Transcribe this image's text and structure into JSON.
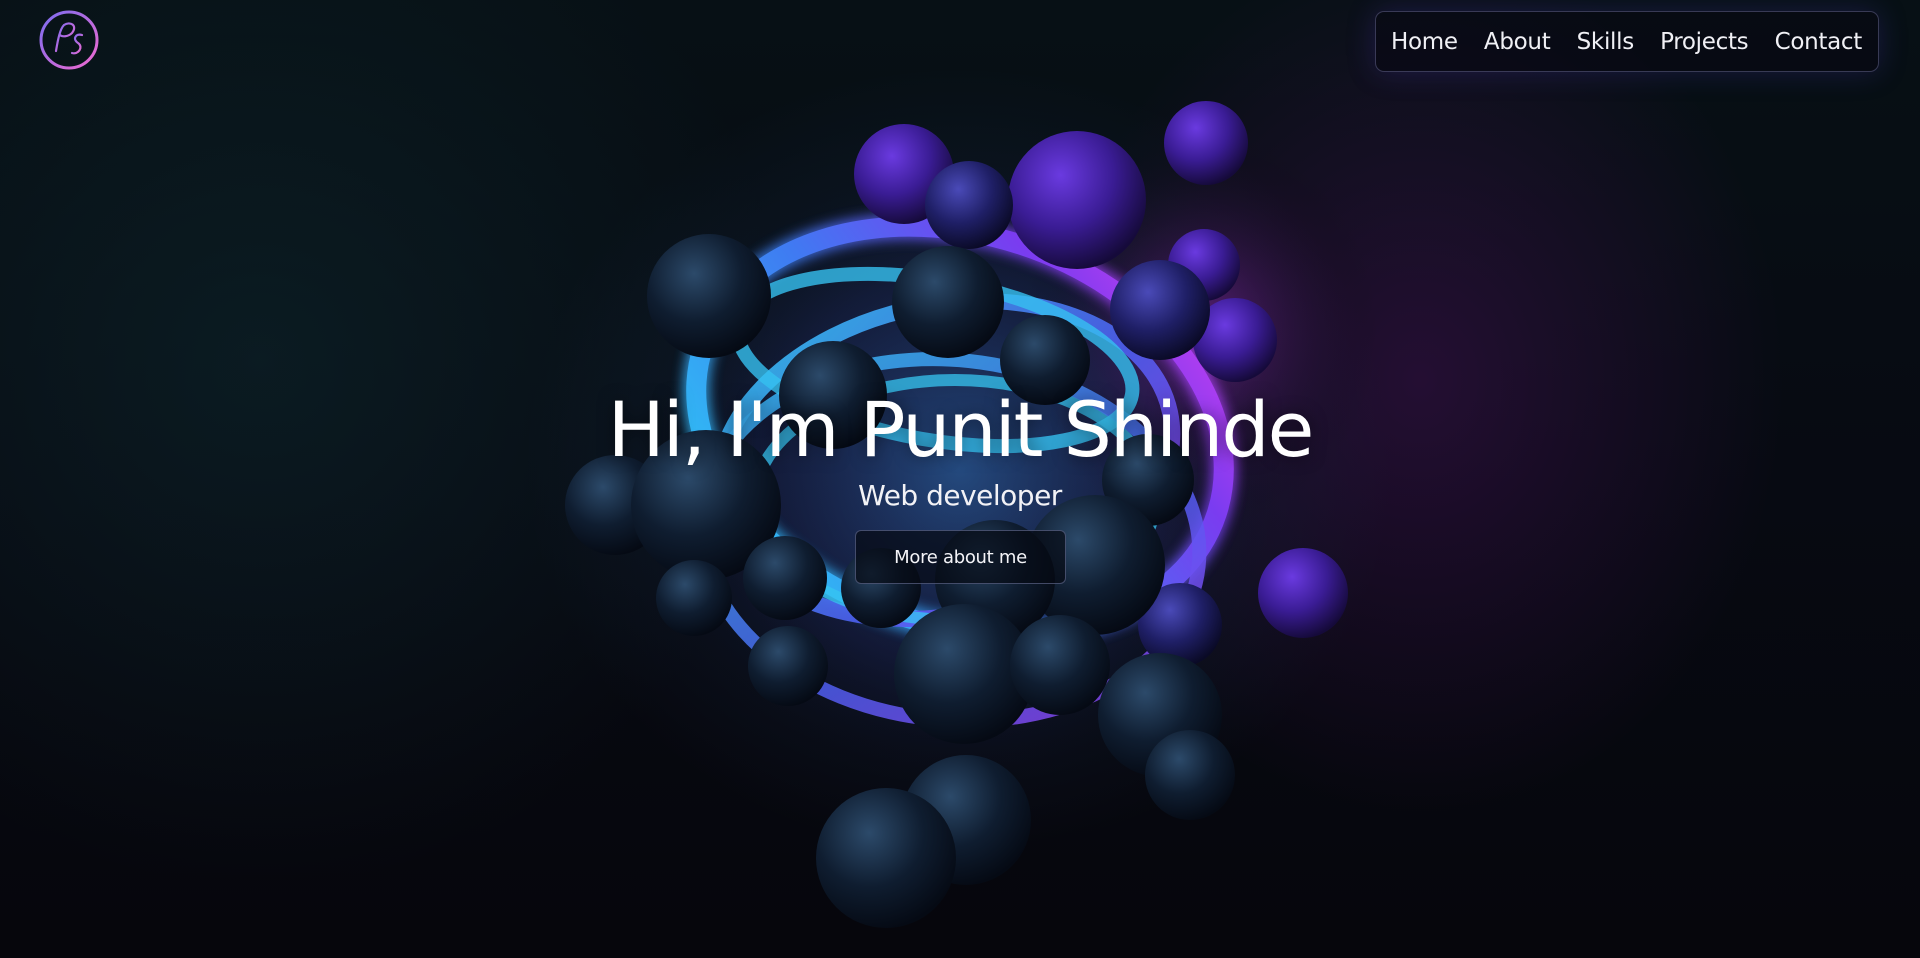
{
  "logo": {
    "text": "Ps",
    "icon": "ps-monogram-logo"
  },
  "nav": {
    "items": [
      {
        "label": "Home"
      },
      {
        "label": "About"
      },
      {
        "label": "Skills"
      },
      {
        "label": "Projects"
      },
      {
        "label": "Contact"
      }
    ]
  },
  "hero": {
    "title": "Hi, I'm Punit Shinde",
    "subtitle": "Web developer",
    "button_label": "More about me"
  },
  "colors": {
    "background": "#05070d",
    "accent_cyan": "#2fc8f2",
    "accent_blue": "#4a63f5",
    "accent_magenta": "#d23cf0",
    "text": "#ffffff"
  }
}
